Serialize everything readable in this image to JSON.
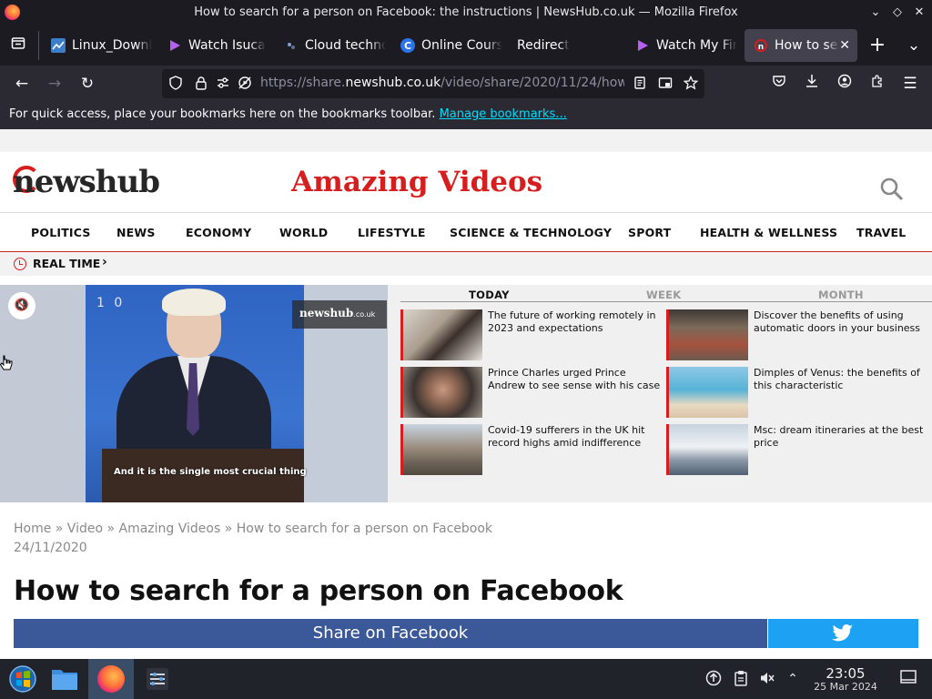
{
  "window": {
    "title": "How to search for a person on Facebook: the instructions | NewsHub.co.uk — Mozilla Firefox"
  },
  "tabs": [
    {
      "label": "Linux_Downl",
      "icon": "chart-icon"
    },
    {
      "label": "Watch Isuca",
      "icon": "play-icon"
    },
    {
      "label": "Cloud techno",
      "icon": "cloud-icon"
    },
    {
      "label": "Online Cours",
      "icon": "c-logo-icon"
    },
    {
      "label": "Redirect",
      "icon": ""
    },
    {
      "label": "Watch My Fir",
      "icon": "play-icon"
    },
    {
      "label": "How to sea",
      "icon": "newshub-icon",
      "active": true
    }
  ],
  "address": {
    "prefix": "https://share.",
    "domain": "newshub.co.uk",
    "path": "/video/share/2020/11/24/how"
  },
  "bookmarks": {
    "message": "For quick access, place your bookmarks here on the bookmarks toolbar.",
    "link": "Manage bookmarks..."
  },
  "site": {
    "logo": "newshub",
    "section_title": "Amazing Videos",
    "nav": [
      "POLITICS",
      "NEWS",
      "ECONOMY",
      "WORLD",
      "LIFESTYLE",
      "SCIENCE & TECHNOLOGY",
      "SPORT",
      "HEALTH & WELLNESS",
      "TRAVEL"
    ],
    "realtime_label": "REAL TIME"
  },
  "video": {
    "caption": "And it is the single most crucial thing",
    "badge": "1 0",
    "logo": "newshub",
    "logo_suffix": ".co.uk"
  },
  "related": {
    "tabs": [
      "TODAY",
      "WEEK",
      "MONTH"
    ],
    "items": [
      {
        "text": "The future of working remotely in 2023 and expectations"
      },
      {
        "text": "Discover the benefits of using automatic doors in your business"
      },
      {
        "text": "Prince Charles urged Prince Andrew to see sense with his case"
      },
      {
        "text": "Dimples of Venus: the benefits of this characteristic"
      },
      {
        "text": "Covid-19 sufferers in the UK hit record highs amid indifference"
      },
      {
        "text": "Msc: dream itineraries at the best price"
      }
    ]
  },
  "article": {
    "breadcrumb": "Home » Video » Amazing Videos » How to search for a person on Facebook",
    "date": "24/11/2020",
    "headline": "How to search for a person on Facebook",
    "share_facebook": "Share on Facebook"
  },
  "taskbar": {
    "time": "23:05",
    "date": "25 Mar 2024"
  },
  "colors": {
    "brand_red": "#d71e1e",
    "facebook": "#3b5998",
    "twitter": "#1da1f2"
  }
}
